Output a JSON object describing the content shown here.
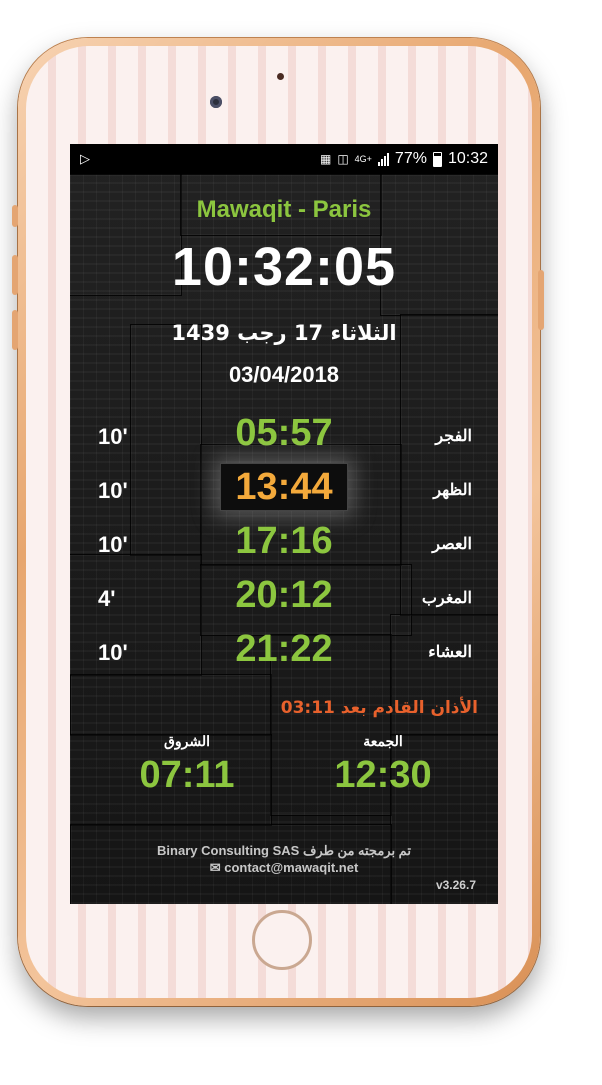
{
  "status_bar": {
    "battery": "77%",
    "time": "10:32",
    "network": "4G+"
  },
  "app": {
    "title": "Mawaqit - Paris",
    "clock": "10:32:05",
    "hijri_date": "الثلاثاء 17 رجب 1439",
    "gregorian_date": "03/04/2018"
  },
  "prayers": [
    {
      "name": "الفجر",
      "time": "05:57",
      "iqama": "10'"
    },
    {
      "name": "الظهر",
      "time": "13:44",
      "iqama": "10'",
      "active": true
    },
    {
      "name": "العصر",
      "time": "17:16",
      "iqama": "10'"
    },
    {
      "name": "المغرب",
      "time": "20:12",
      "iqama": "4'"
    },
    {
      "name": "العشاء",
      "time": "21:22",
      "iqama": "10'"
    }
  ],
  "next_adhan": {
    "label": "الأذان القادم بعد",
    "countdown": "03:11"
  },
  "extra_times": {
    "shuruq_label": "الشروق",
    "shuruq_time": "07:11",
    "jumua_label": "الجمعة",
    "jumua_time": "12:30"
  },
  "footer": {
    "credit": "Binary Consulting SAS تم برمجته من طرف",
    "contact": "contact@mawaqit.net",
    "version": "v3.26.7"
  },
  "colors": {
    "accent_green": "#8cc63f",
    "active_orange": "#f3a93b",
    "next_red": "#e8612c",
    "phone_gold": "#e7a66e"
  },
  "icons": {
    "play_store": "play-store-icon",
    "mail": "mail-icon",
    "cast": "cast-icon",
    "battery": "battery-icon"
  }
}
